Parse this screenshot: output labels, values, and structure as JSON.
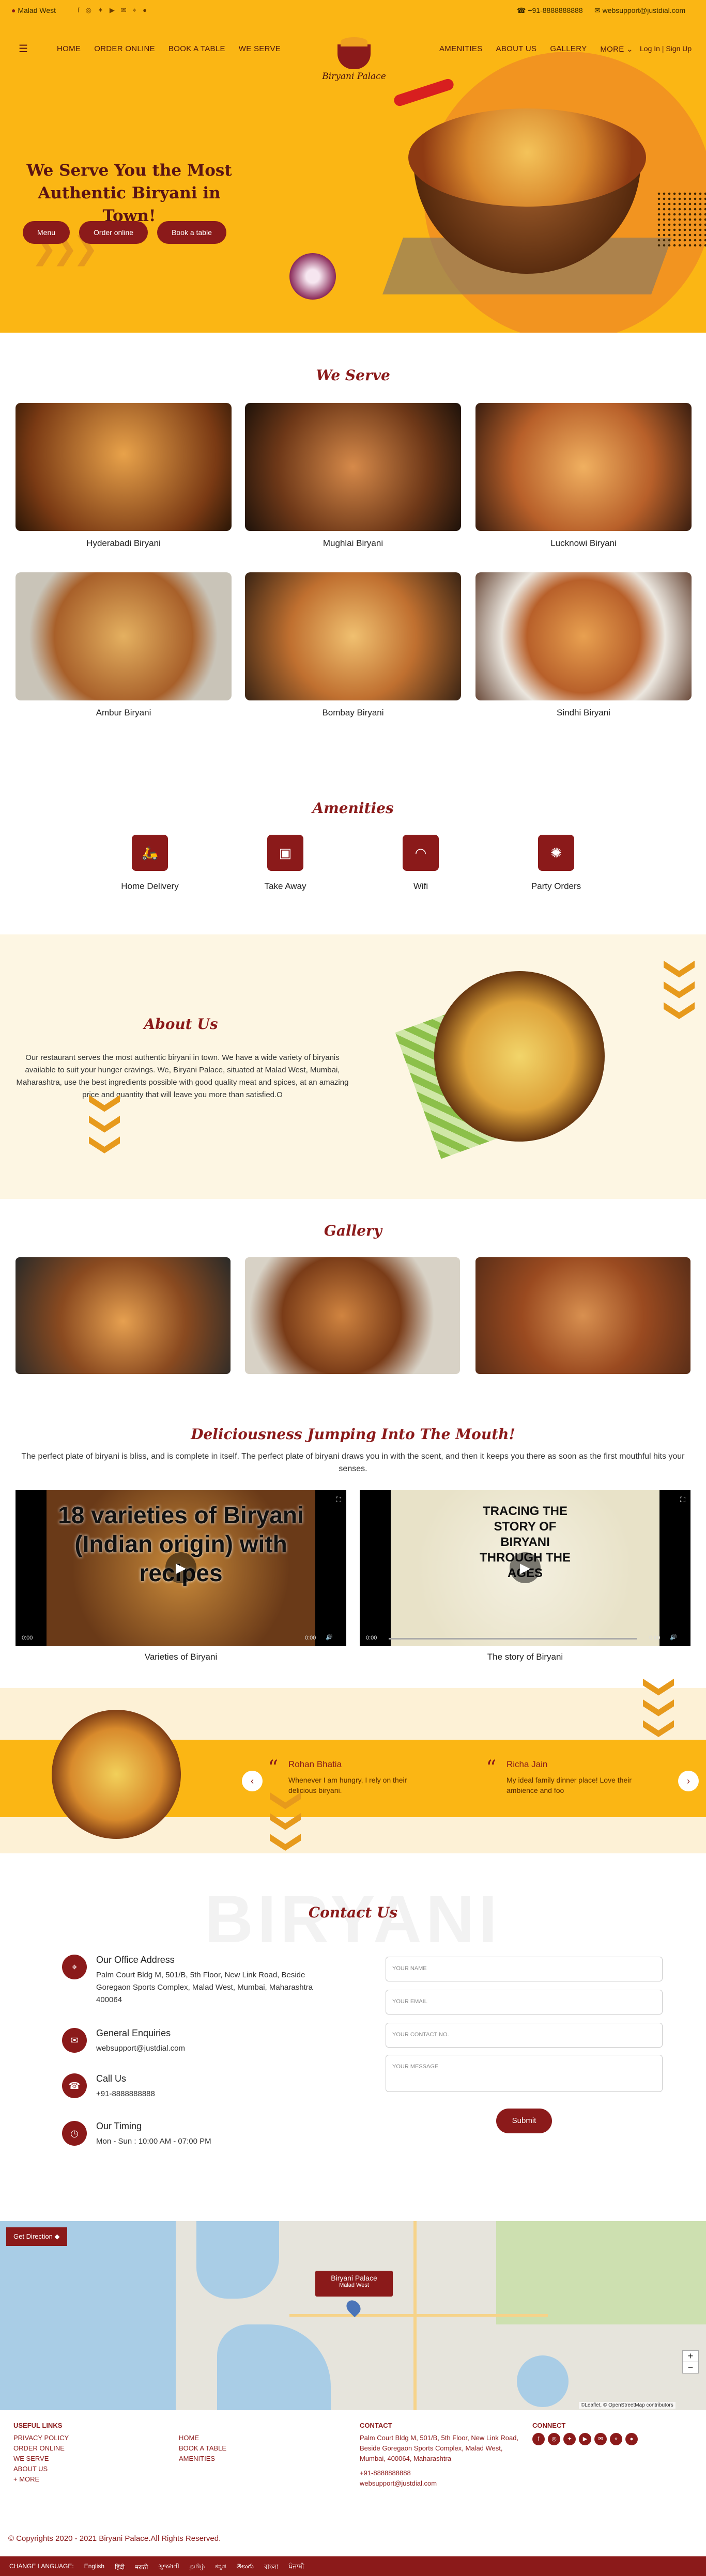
{
  "topbar": {
    "location": "Malad West",
    "phone": "+91-8888888888",
    "email": "websupport@justdial.com",
    "social_icons": [
      "facebook-icon",
      "instagram-icon",
      "twitter-icon",
      "youtube-icon",
      "mail-icon",
      "location-icon",
      "chat-icon"
    ]
  },
  "nav": {
    "left": [
      "HOME",
      "ORDER ONLINE",
      "BOOK A TABLE",
      "WE SERVE"
    ],
    "right": [
      "AMENITIES",
      "ABOUT US",
      "GALLERY",
      "MORE"
    ],
    "auth": "Log In | Sign Up",
    "logo_text": "Biryani Palace"
  },
  "hero": {
    "title": "We Serve You the Most Authentic Biryani in Town!",
    "buttons": [
      "Menu",
      "Order online",
      "Book a table"
    ]
  },
  "we_serve": {
    "title": "We Serve",
    "items": [
      "Hyderabadi Biryani",
      "Mughlai Biryani",
      "Lucknowi Biryani",
      "Ambur Biryani",
      "Bombay Biryani",
      "Sindhi Biryani"
    ]
  },
  "amenities": {
    "title": "Amenities",
    "items": [
      "Home Delivery",
      "Take Away",
      "Wifi",
      "Party Orders"
    ]
  },
  "about": {
    "title": "About Us",
    "text": "Our restaurant serves the most authentic biryani in town. We have a wide variety of biryanis available to suit your hunger cravings. We, Biryani Palace, situated at Malad West, Mumbai, Maharashtra, use the best ingredients possible with good quality meat and spices, at an amazing price and quantity that will leave you more than satisfied.O"
  },
  "gallery": {
    "title": "Gallery"
  },
  "videos": {
    "title": "Deliciousness Jumping Into The Mouth!",
    "text": "The perfect plate of biryani is bliss, and is complete in itself. The perfect plate of biryani draws you in with the scent, and then it keeps you there as soon as the first mouthful hits your senses.",
    "items": [
      {
        "overlay": "18 varieties of Biryani (Indian origin) with recipes",
        "label": "Varieties of Biryani",
        "time_left": "0:00",
        "time_right": "0:00"
      },
      {
        "overlay": "TRACING THE STORY OF BIRYANI THROUGH THE AGES",
        "label": "The story of Biryani",
        "time_left": "0:00",
        "time_right": "0:00"
      }
    ]
  },
  "testimonials": [
    {
      "name": "Rohan Bhatia",
      "message": "Whenever I am hungry, I rely on their delicious biryani."
    },
    {
      "name": "Richa Jain",
      "message": "My ideal family dinner place! Love their ambience and foo"
    }
  ],
  "contact": {
    "watermark": "BIRYANI",
    "title": "Contact Us",
    "blocks": [
      {
        "heading": "Our Office Address",
        "body": "Palm Court Bldg M, 501/B, 5th Floor, New Link Road, Beside Goregaon Sports Complex, Malad West, Mumbai, Maharashtra 400064"
      },
      {
        "heading": "General Enquiries",
        "body": "websupport@justdial.com"
      },
      {
        "heading": "Call Us",
        "body": "+91-8888888888"
      },
      {
        "heading": "Our Timing",
        "body": "Mon - Sun : 10:00 AM - 07:00 PM"
      }
    ],
    "placeholders": {
      "name": "YOUR NAME",
      "email": "YOUR EMAIL",
      "contact": "YOUR CONTACT NO.",
      "message": "YOUR MESSAGE"
    },
    "submit": "Submit"
  },
  "map": {
    "get_direction": "Get Direction",
    "popup_title": "Biryani Palace",
    "popup_sub": "Malad West",
    "attribution": "©Leaflet, © OpenStreetMap contributors"
  },
  "footer": {
    "useful_links_title": "USEFUL LINKS",
    "links_col1": [
      "PRIVACY POLICY",
      "ORDER ONLINE",
      "WE SERVE",
      "ABOUT US",
      "+ MORE"
    ],
    "links_col2": [
      "HOME",
      "BOOK A TABLE",
      "AMENITIES"
    ],
    "contact_title": "CONTACT",
    "contact_address": "Palm Court Bldg M, 501/B, 5th Floor, New Link Road, Beside Goregaon Sports Complex, Malad West, Mumbai, 400064, Maharashtra",
    "contact_phone": "+91-8888888888",
    "contact_email": "websupport@justdial.com",
    "connect_title": "CONNECT",
    "copyright": "© Copyrights 2020 - 2021 Biryani Palace.All Rights Reserved.",
    "change_language": "CHANGE LANGUAGE:",
    "languages": [
      "English",
      "हिंदी",
      "मराठी",
      "ગુજરાતી",
      "தமிழ்",
      "ಕನ್ನಡ",
      "తెలుగు",
      "বাংলা",
      "ਪੰਜਾਬੀ"
    ]
  }
}
